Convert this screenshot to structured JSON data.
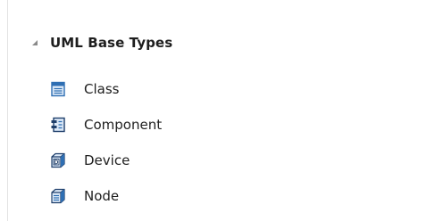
{
  "toolbox": {
    "group": {
      "title": "UML Base Types",
      "expanded": true,
      "arrow_icon": "collapse-triangle-icon"
    },
    "items": [
      {
        "label": "Class",
        "icon": "class-icon"
      },
      {
        "label": "Component",
        "icon": "component-icon"
      },
      {
        "label": "Device",
        "icon": "device-icon"
      },
      {
        "label": "Node",
        "icon": "node-icon"
      }
    ]
  },
  "colors": {
    "icon_blue": "#2f6fb3",
    "icon_dark": "#1f3f6b",
    "icon_fill": "#dce9f8",
    "arrow": "#8a8a8a"
  }
}
